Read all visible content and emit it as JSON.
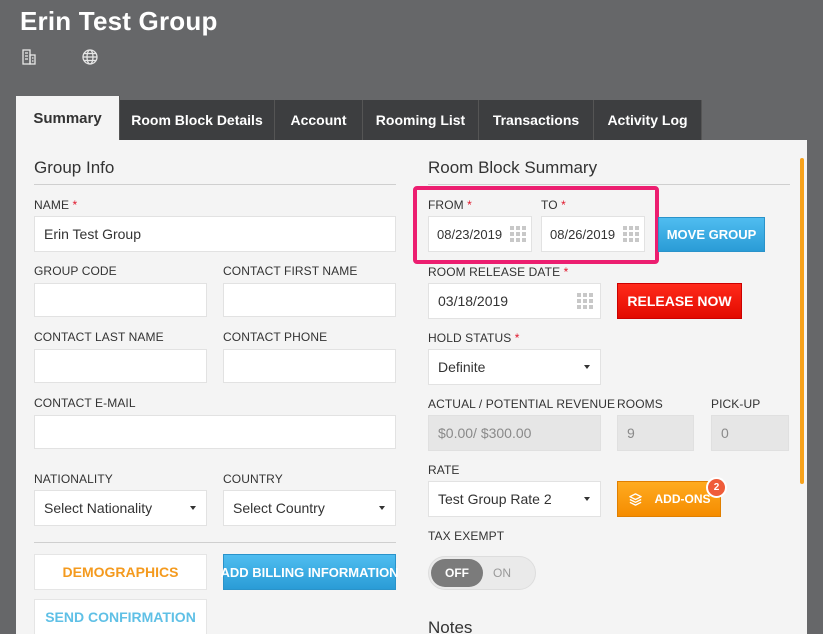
{
  "header": {
    "title": "Erin Test Group",
    "icons": [
      "building-icon",
      "globe-icon"
    ]
  },
  "tabs": [
    {
      "label": "Summary",
      "active": true
    },
    {
      "label": "Room Block Details"
    },
    {
      "label": "Account"
    },
    {
      "label": "Rooming List"
    },
    {
      "label": "Transactions"
    },
    {
      "label": "Activity Log"
    }
  ],
  "group_info": {
    "title": "Group Info",
    "name_label": "NAME",
    "name_value": "Erin Test Group",
    "group_code_label": "GROUP CODE",
    "group_code_value": "",
    "contact_first_name_label": "CONTACT FIRST NAME",
    "contact_first_name_value": "",
    "contact_last_name_label": "CONTACT LAST NAME",
    "contact_last_name_value": "",
    "contact_phone_label": "CONTACT PHONE",
    "contact_phone_value": "",
    "contact_email_label": "CONTACT E-MAIL",
    "contact_email_value": "",
    "nationality_label": "NATIONALITY",
    "nationality_value": "Select Nationality",
    "country_label": "COUNTRY",
    "country_value": "Select Country",
    "demographics_label": "DEMOGRAPHICS",
    "add_billing_label": "ADD BILLING INFORMATION",
    "send_confirmation_label": "SEND CONFIRMATION"
  },
  "room_block": {
    "title": "Room Block Summary",
    "from_label": "FROM",
    "from_value": "08/23/2019",
    "to_label": "TO",
    "to_value": "08/26/2019",
    "move_group_label": "MOVE GROUP",
    "release_date_label": "ROOM RELEASE DATE",
    "release_date_value": "03/18/2019",
    "release_now_label": "RELEASE NOW",
    "hold_status_label": "HOLD STATUS",
    "hold_status_value": "Definite",
    "revenue_label": "ACTUAL / POTENTIAL REVENUE",
    "revenue_value": "$0.00/ $300.00",
    "rooms_label": "ROOMS",
    "rooms_value": "9",
    "pickup_label": "PICK-UP",
    "pickup_value": "0",
    "rate_label": "RATE",
    "rate_value": "Test Group Rate 2",
    "addons_label": "ADD-ONS",
    "addons_count": "2",
    "tax_exempt_label": "TAX EXEMPT",
    "tax_off_label": "OFF",
    "tax_on_label": "ON",
    "notes_title": "Notes"
  },
  "colors": {
    "header_bg": "#666769",
    "tab_dark": "#3d3e40",
    "panel_bg": "#f4f4f4",
    "accent_orange": "#f7a21b",
    "highlight_pink": "#ec1e70",
    "required_red": "#e0162b"
  }
}
